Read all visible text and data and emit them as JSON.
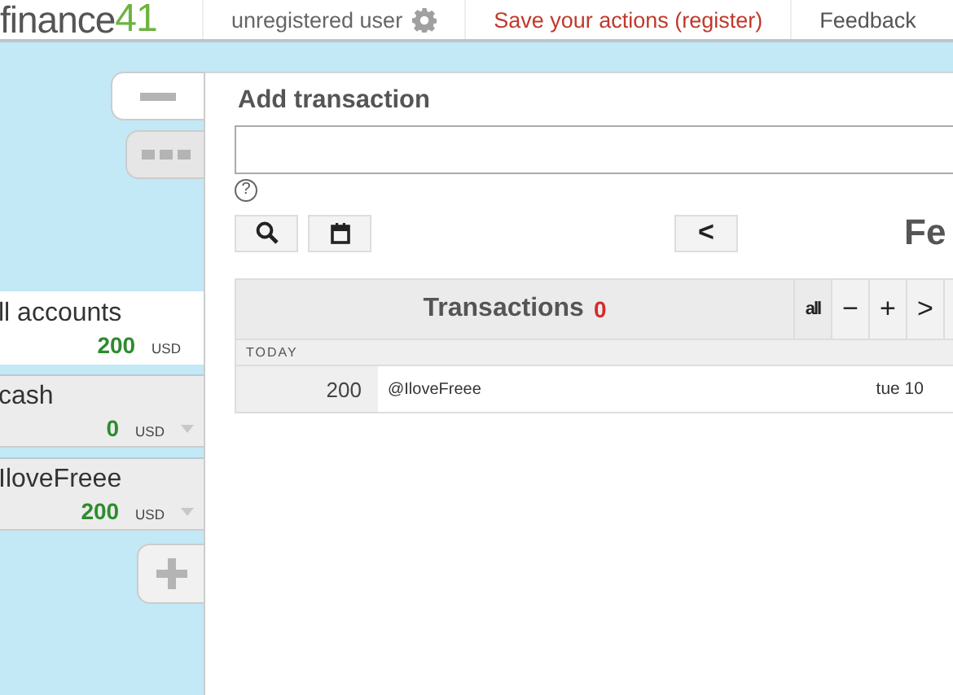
{
  "header": {
    "logo": {
      "word": "finance",
      "digits": "41"
    },
    "user": "unregistered user",
    "register_link": "Save your actions (register)",
    "feedback": "Feedback"
  },
  "sidebar": {
    "tabs": [
      {
        "kind": "minus",
        "selected": true
      },
      {
        "kind": "dots",
        "selected": false
      }
    ],
    "accounts": [
      {
        "name": "ll accounts",
        "amount": "200",
        "currency": "USD",
        "selected": true,
        "has_menu": false
      },
      {
        "name": "cash",
        "amount": "0",
        "currency": "USD",
        "selected": false,
        "has_menu": true
      },
      {
        "name": "IloveFreee",
        "amount": "200",
        "currency": "USD",
        "selected": false,
        "has_menu": true
      }
    ]
  },
  "add_transaction": {
    "title": "Add transaction",
    "help": "?"
  },
  "toolbar": {
    "prev": "<",
    "month": "Fe"
  },
  "transactions": {
    "title": "Transactions",
    "count": "0",
    "filters": [
      {
        "label": "all"
      },
      {
        "label": "−"
      },
      {
        "label": "+"
      },
      {
        "label": ">"
      }
    ],
    "groups": [
      {
        "label": "TODAY",
        "rows": [
          {
            "amount": "200",
            "account": "@IloveFreee",
            "date": "tue 10"
          }
        ]
      }
    ]
  }
}
